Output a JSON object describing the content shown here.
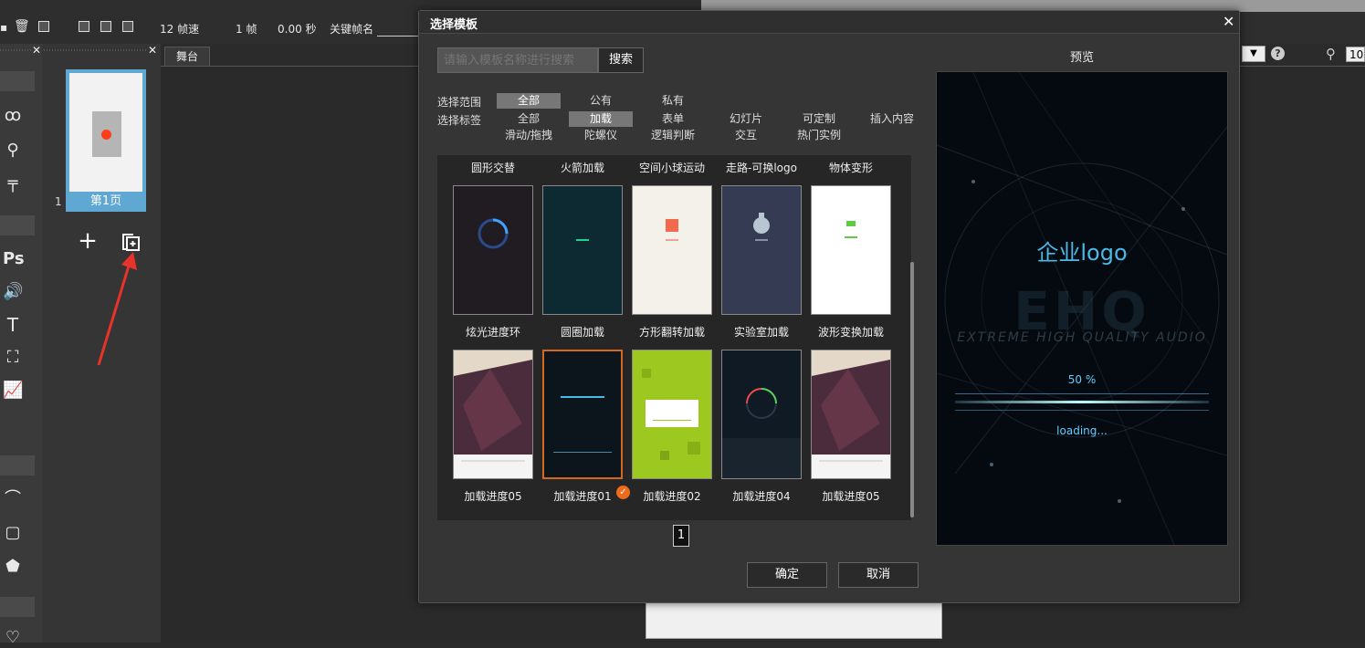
{
  "toolbar": {
    "fps": "12 帧速",
    "frame": "1 帧",
    "seconds": "0.00 秒",
    "keyframe_label": "关键帧名"
  },
  "left_tools": {
    "ps": "Ps",
    "text": "T"
  },
  "pages": {
    "page_number": "1",
    "page_label": "第1页",
    "add_symbol": "+"
  },
  "stage": {
    "tab": "舞台"
  },
  "right_controls": {
    "help": "?",
    "zoom_value": "10",
    "select_arrow": "▼"
  },
  "dialog": {
    "title": "选择模板",
    "close": "✕",
    "search": {
      "placeholder": "请输入模板名称进行搜索",
      "button": "搜索"
    },
    "range_label": "选择范围",
    "range_options": [
      "全部",
      "公有",
      "私有"
    ],
    "range_selected": "全部",
    "tag_label": "选择标签",
    "tag_options_row1": [
      "全部",
      "加载",
      "表单",
      "幻灯片",
      "可定制",
      "插入内容"
    ],
    "tag_options_row2": [
      "滑动/拖拽",
      "陀螺仪",
      "逻辑判断",
      "交互",
      "热门实例"
    ],
    "tag_selected": "加载",
    "top_row_labels": [
      "圆形交替",
      "火箭加载",
      "空间小球运动",
      "走路-可换logo",
      "物体变形"
    ],
    "row1": [
      {
        "name": "炫光进度环",
        "color": "#201c22"
      },
      {
        "name": "圆圈加载",
        "color": "#0d2a33"
      },
      {
        "name": "方形翻转加载",
        "color": "#f3f1ea"
      },
      {
        "name": "实验室加载",
        "color": "#353b52"
      },
      {
        "name": "波形变换加载",
        "color": "#ffffff"
      }
    ],
    "row2": [
      {
        "name": "加载进度05",
        "color": "#3a2a3a"
      },
      {
        "name": "加载进度01",
        "color": "#0c141c"
      },
      {
        "name": "加载进度02",
        "color": "#9cc820"
      },
      {
        "name": "加载进度04",
        "color": "#0f1a24"
      },
      {
        "name": "加载进度05",
        "color": "#3a2a3a"
      }
    ],
    "selected_check": "✓",
    "page": "1",
    "confirm": "确定",
    "cancel": "取消",
    "preview": {
      "title": "预览",
      "logo": "企业logo",
      "percent": "50 %",
      "loading": "loading..."
    }
  }
}
